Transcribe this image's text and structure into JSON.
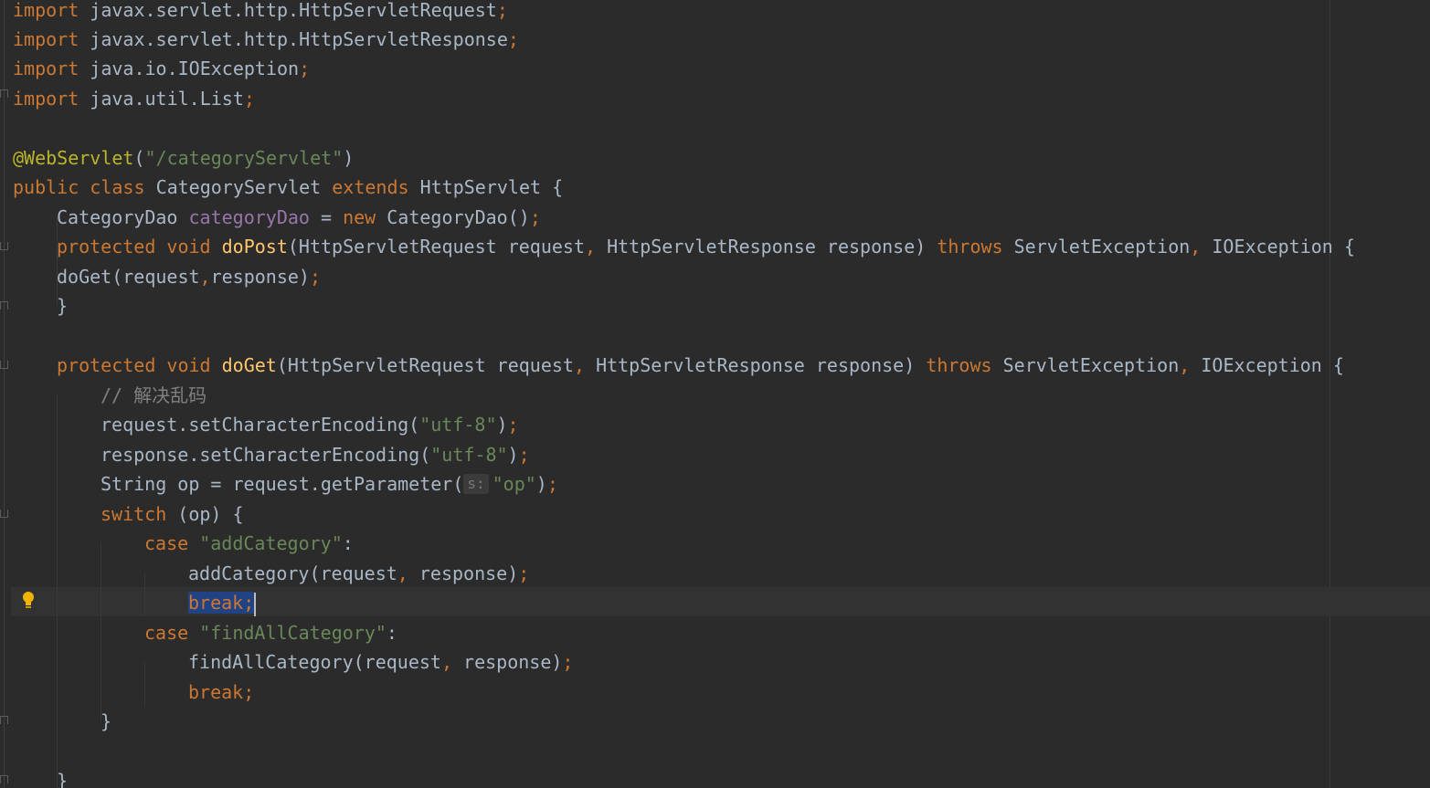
{
  "editor": {
    "language": "java",
    "lines": [
      {
        "kw1": "import",
        "rest": "javax.servlet.http.HttpServletRequest",
        "semi": ";"
      },
      {
        "kw1": "import",
        "rest": "javax.servlet.http.HttpServletResponse",
        "semi": ";"
      },
      {
        "kw1": "import",
        "rest": "java.io.IOException",
        "semi": ";"
      },
      {
        "kw1": "import",
        "rest": "java.util.List",
        "semi": ";"
      }
    ],
    "annotation": {
      "name": "@WebServlet",
      "open": "(",
      "value": "\"/categoryServlet\"",
      "close": ")"
    },
    "class_decl": {
      "mod": "public",
      "kw": "class",
      "name": "CategoryServlet",
      "ext": "extends",
      "parent": "HttpServlet",
      "brace": "{"
    },
    "field_decl": {
      "type": "CategoryDao",
      "name": "categoryDao",
      "eq": "=",
      "kw": "new",
      "ctor": "CategoryDao()",
      "semi": ";"
    },
    "dopost": {
      "mod": "protected",
      "ret": "void",
      "name": "doPost",
      "params1": "(HttpServletRequest request",
      "comma1": ",",
      "params2": "HttpServletResponse response)",
      "throws": "throws",
      "ex1": "ServletException",
      "comma2": ",",
      "ex2": "IOException",
      "brace": "{"
    },
    "doget_call": {
      "text": "doGet(request",
      "comma": ",",
      "rest": "response)",
      "semi": ";"
    },
    "close_brace": "}",
    "doget": {
      "mod": "protected",
      "ret": "void",
      "name": "doGet",
      "params1": "(HttpServletRequest request",
      "comma1": ",",
      "params2": "HttpServletResponse response)",
      "throws": "throws",
      "ex1": "ServletException",
      "comma2": ",",
      "ex2": "IOException",
      "brace": "{"
    },
    "comment": "// 解决乱码",
    "req_enc": {
      "text": "request.setCharacterEncoding(",
      "str": "\"utf-8\"",
      "close": ")",
      "semi": ";"
    },
    "resp_enc": {
      "text": "response.setCharacterEncoding(",
      "str": "\"utf-8\"",
      "close": ")",
      "semi": ";"
    },
    "param_line": {
      "text": "String op = request.getParameter(",
      "hint": "s:",
      "str": "\"op\"",
      "close": ")",
      "semi": ";"
    },
    "switch_line": {
      "kw": "switch",
      "rest": "(op) {"
    },
    "case1": {
      "kw": "case",
      "str": "\"addCategory\"",
      "colon": ":"
    },
    "call1": {
      "text": "addCategory(request",
      "comma": ",",
      "rest": "response)",
      "semi": ";"
    },
    "break1": {
      "kw": "break",
      "semi": ";"
    },
    "case2": {
      "kw": "case",
      "str": "\"findAllCategory\"",
      "colon": ":"
    },
    "call2": {
      "text": "findAllCategory(request",
      "comma": ",",
      "rest": "response)",
      "semi": ";"
    },
    "break2": {
      "kw": "break",
      "semi": ";"
    },
    "switch_close": "}",
    "method_close": "}"
  },
  "colors": {
    "background": "#2b2b2b",
    "keyword": "#cc7832",
    "plain": "#a9b7c6",
    "string": "#6a8759",
    "annotation": "#bbb529",
    "field": "#9876aa",
    "method_decl": "#ffc66d",
    "comment": "#808080",
    "selection": "#214283",
    "current_line": "#323232"
  },
  "icons": [
    "intention-bulb-icon",
    "fold-marker-icon"
  ]
}
